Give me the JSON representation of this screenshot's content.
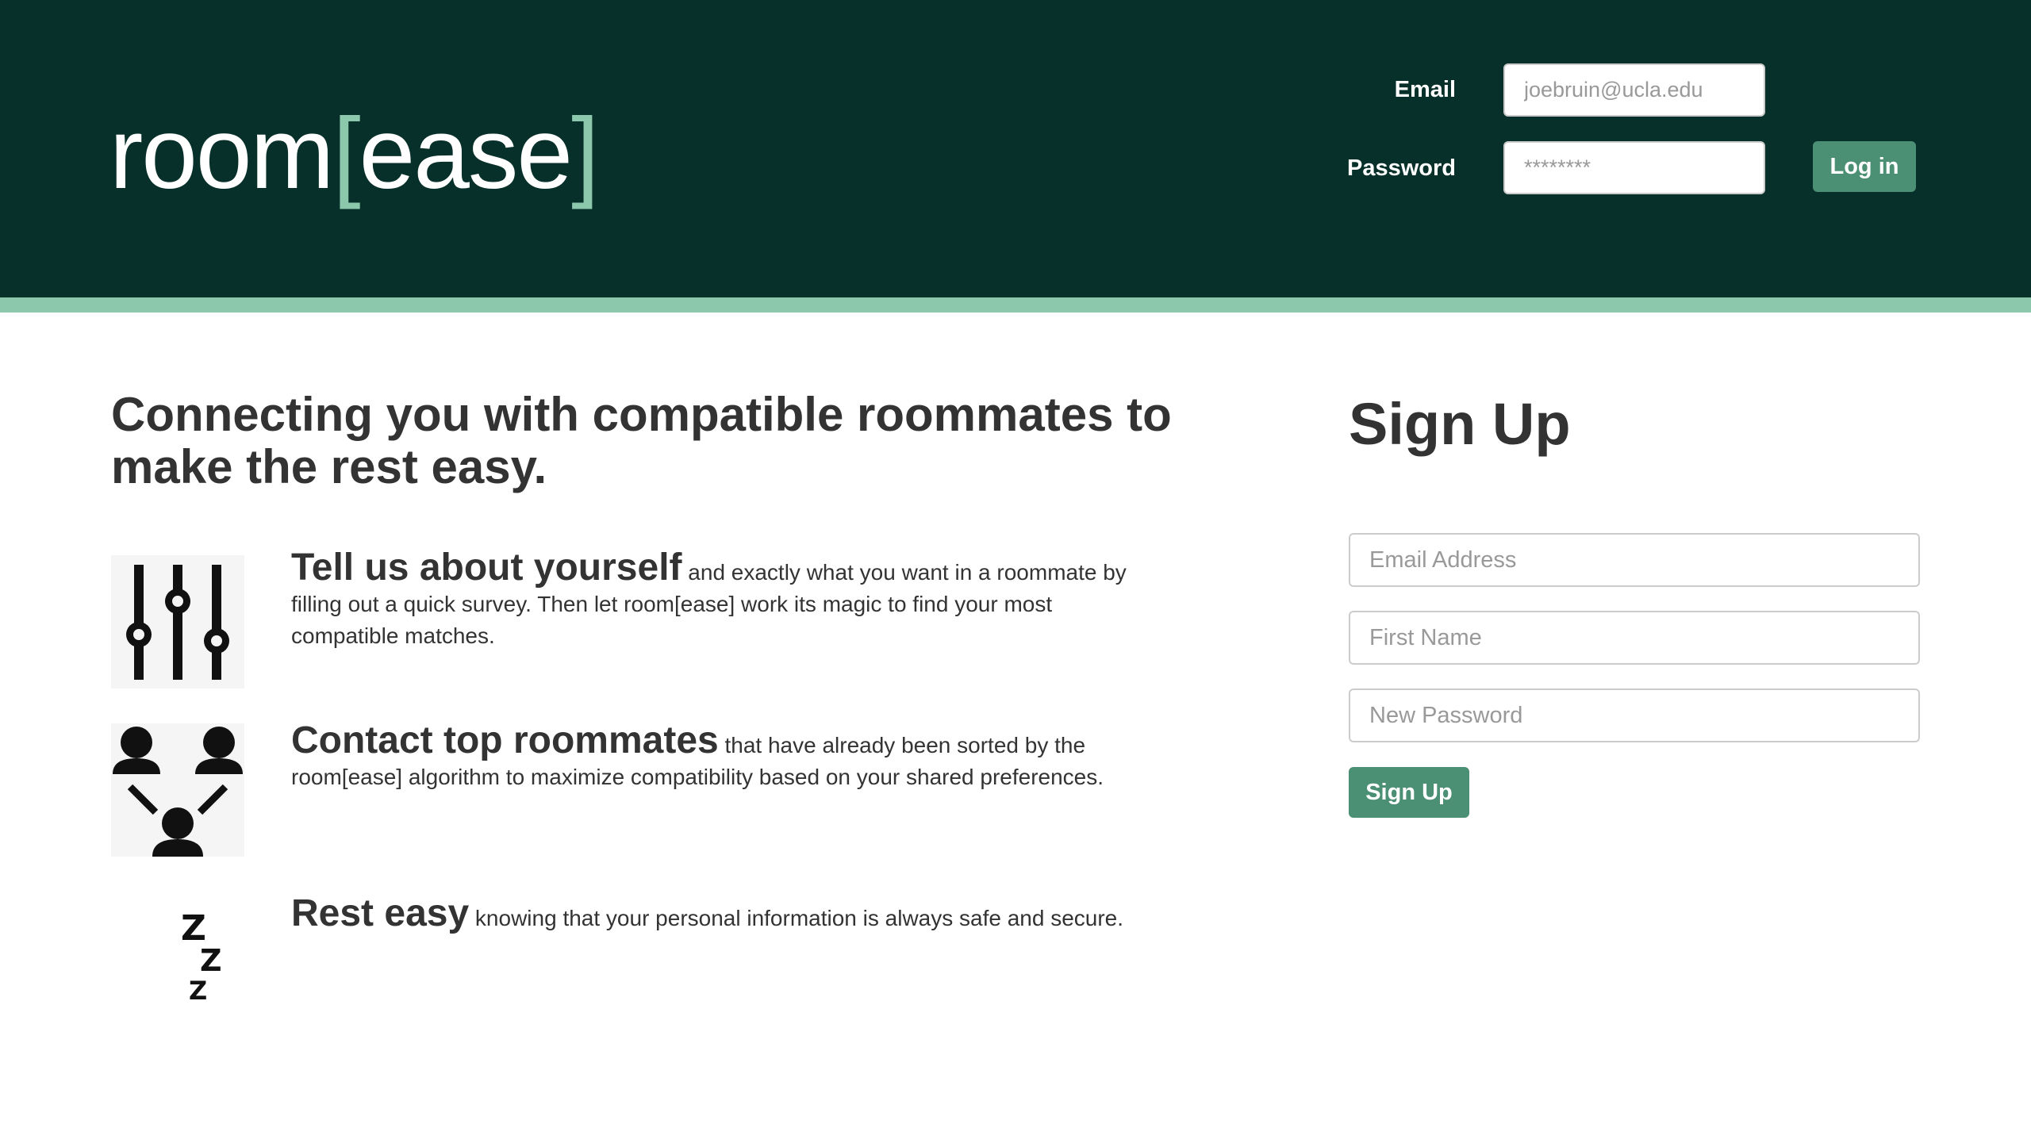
{
  "header": {
    "logo_main": "room",
    "logo_open_bracket": "[",
    "logo_accent": "ease",
    "logo_close_bracket": "]",
    "email_label": "Email",
    "email_placeholder": "joebruin@ucla.edu",
    "password_label": "Password",
    "password_placeholder": "********",
    "login_button": "Log in",
    "colors": {
      "background": "#08302a",
      "accent": "#8cc8ac",
      "button": "#4b8f74"
    }
  },
  "main": {
    "tagline": "Connecting you with compatible roommates to make the rest easy.",
    "features": [
      {
        "icon": "sliders-icon",
        "lead": "Tell us about yourself",
        "text": " and exactly what you want in a roommate by filling out a quick survey. Then let room[ease] work its magic to find your most compatible matches."
      },
      {
        "icon": "people-connect-icon",
        "lead": "Contact top roommates",
        "text": " that have already been sorted by the room[ease] algorithm to maximize compatibility based on your shared preferences."
      },
      {
        "icon": "moon-sleep-icon",
        "lead": "Rest easy",
        "text": " knowing that your personal information is always safe and secure."
      }
    ]
  },
  "signup": {
    "title": "Sign Up",
    "email_placeholder": "Email Address",
    "first_name_placeholder": "First Name",
    "password_placeholder": "New Password",
    "button": "Sign Up"
  }
}
